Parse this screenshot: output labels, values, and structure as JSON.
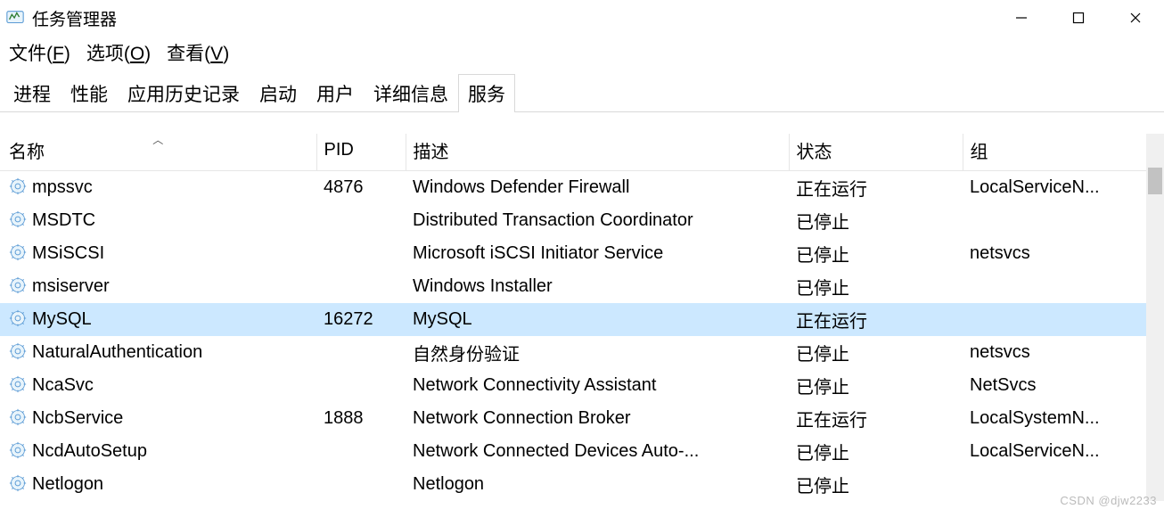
{
  "window": {
    "title": "任务管理器"
  },
  "menu": {
    "file": "文件(F)",
    "options": "选项(O)",
    "view": "查看(V)"
  },
  "tabs": [
    {
      "label": "进程",
      "active": false
    },
    {
      "label": "性能",
      "active": false
    },
    {
      "label": "应用历史记录",
      "active": false
    },
    {
      "label": "启动",
      "active": false
    },
    {
      "label": "用户",
      "active": false
    },
    {
      "label": "详细信息",
      "active": false
    },
    {
      "label": "服务",
      "active": true
    }
  ],
  "columns": {
    "name": "名称",
    "pid": "PID",
    "desc": "描述",
    "status": "状态",
    "group": "组"
  },
  "rows": [
    {
      "name": "mpssvc",
      "pid": "4876",
      "desc": "Windows Defender Firewall",
      "status": "正在运行",
      "group": "LocalServiceN...",
      "selected": false
    },
    {
      "name": "MSDTC",
      "pid": "",
      "desc": "Distributed Transaction Coordinator",
      "status": "已停止",
      "group": "",
      "selected": false
    },
    {
      "name": "MSiSCSI",
      "pid": "",
      "desc": "Microsoft iSCSI Initiator Service",
      "status": "已停止",
      "group": "netsvcs",
      "selected": false
    },
    {
      "name": "msiserver",
      "pid": "",
      "desc": "Windows Installer",
      "status": "已停止",
      "group": "",
      "selected": false
    },
    {
      "name": "MySQL",
      "pid": "16272",
      "desc": "MySQL",
      "status": "正在运行",
      "group": "",
      "selected": true
    },
    {
      "name": "NaturalAuthentication",
      "pid": "",
      "desc": "自然身份验证",
      "status": "已停止",
      "group": "netsvcs",
      "selected": false
    },
    {
      "name": "NcaSvc",
      "pid": "",
      "desc": "Network Connectivity Assistant",
      "status": "已停止",
      "group": "NetSvcs",
      "selected": false
    },
    {
      "name": "NcbService",
      "pid": "1888",
      "desc": "Network Connection Broker",
      "status": "正在运行",
      "group": "LocalSystemN...",
      "selected": false
    },
    {
      "name": "NcdAutoSetup",
      "pid": "",
      "desc": "Network Connected Devices Auto-...",
      "status": "已停止",
      "group": "LocalServiceN...",
      "selected": false
    },
    {
      "name": "Netlogon",
      "pid": "",
      "desc": "Netlogon",
      "status": "已停止",
      "group": "",
      "selected": false
    }
  ],
  "watermark": "CSDN @djw2233"
}
